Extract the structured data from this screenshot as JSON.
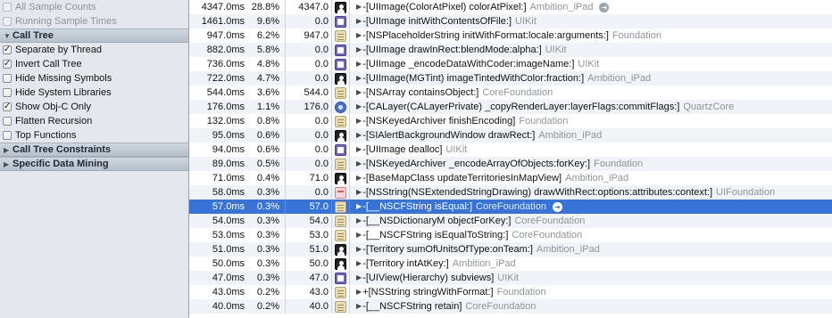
{
  "sidebar": {
    "sample_options": [
      {
        "label": "All Sample Counts",
        "checked": false,
        "disabled": true
      },
      {
        "label": "Running Sample Times",
        "checked": false,
        "disabled": true
      }
    ],
    "call_tree": {
      "title": "Call Tree",
      "options": [
        {
          "label": "Separate by Thread",
          "checked": true
        },
        {
          "label": "Invert Call Tree",
          "checked": true
        },
        {
          "label": "Hide Missing Symbols",
          "checked": false
        },
        {
          "label": "Hide System Libraries",
          "checked": false
        },
        {
          "label": "Show Obj-C Only",
          "checked": true
        },
        {
          "label": "Flatten Recursion",
          "checked": false
        },
        {
          "label": "Top Functions",
          "checked": false
        }
      ]
    },
    "call_tree_constraints": {
      "title": "Call Tree Constraints"
    },
    "specific_data_mining": {
      "title": "Specific Data Mining"
    }
  },
  "check_glyph": "✓",
  "table": {
    "selected_index": 14,
    "rows": [
      {
        "time": "4347.0ms",
        "pct": "28.8%",
        "self": "4347.0",
        "icon": "user",
        "symbol": "-[UIImage(ColorAtPixel) colorAtPixel:]",
        "library": "Ambition_iPad",
        "arrow": true
      },
      {
        "time": "1461.0ms",
        "pct": "9.6%",
        "self": "0.0",
        "icon": "kit",
        "symbol": "-[UIImage initWithContentsOfFile:]",
        "library": "UIKit"
      },
      {
        "time": "947.0ms",
        "pct": "6.2%",
        "self": "947.0",
        "icon": "fw",
        "symbol": "-[NSPlaceholderString initWithFormat:locale:arguments:]",
        "library": "Foundation"
      },
      {
        "time": "882.0ms",
        "pct": "5.8%",
        "self": "0.0",
        "icon": "kit",
        "symbol": "-[UIImage drawInRect:blendMode:alpha:]",
        "library": "UIKit"
      },
      {
        "time": "736.0ms",
        "pct": "4.8%",
        "self": "0.0",
        "icon": "kit",
        "symbol": "-[UIImage _encodeDataWithCoder:imageName:]",
        "library": "UIKit"
      },
      {
        "time": "722.0ms",
        "pct": "4.7%",
        "self": "0.0",
        "icon": "user",
        "symbol": "-[UIImage(MGTint) imageTintedWithColor:fraction:]",
        "library": "Ambition_iPad"
      },
      {
        "time": "544.0ms",
        "pct": "3.6%",
        "self": "544.0",
        "icon": "fw",
        "symbol": "-[NSArray containsObject:]",
        "library": "CoreFoundation"
      },
      {
        "time": "176.0ms",
        "pct": "1.1%",
        "self": "176.0",
        "icon": "qc",
        "symbol": "-[CALayer(CALayerPrivate) _copyRenderLayer:layerFlags:commitFlags:]",
        "library": "QuartzCore"
      },
      {
        "time": "132.0ms",
        "pct": "0.8%",
        "self": "0.0",
        "icon": "fw",
        "symbol": "-[NSKeyedArchiver finishEncoding]",
        "library": "Foundation"
      },
      {
        "time": "95.0ms",
        "pct": "0.6%",
        "self": "0.0",
        "icon": "user",
        "symbol": "-[SIAlertBackgroundWindow drawRect:]",
        "library": "Ambition_iPad"
      },
      {
        "time": "94.0ms",
        "pct": "0.6%",
        "self": "0.0",
        "icon": "kit",
        "symbol": "-[UIImage dealloc]",
        "library": "UIKit"
      },
      {
        "time": "89.0ms",
        "pct": "0.5%",
        "self": "0.0",
        "icon": "fw",
        "symbol": "-[NSKeyedArchiver _encodeArrayOfObjects:forKey:]",
        "library": "Foundation"
      },
      {
        "time": "71.0ms",
        "pct": "0.4%",
        "self": "71.0",
        "icon": "user",
        "symbol": "-[BaseMapClass updateTerritoriesInMapView]",
        "library": "Ambition_iPad"
      },
      {
        "time": "58.0ms",
        "pct": "0.3%",
        "self": "0.0",
        "icon": "fnd",
        "symbol": "-[NSString(NSExtendedStringDrawing) drawWithRect:options:attributes:context:]",
        "library": "UIFoundation"
      },
      {
        "time": "57.0ms",
        "pct": "0.3%",
        "self": "57.0",
        "icon": "fw",
        "symbol": "-[__NSCFString isEqual:]",
        "library": "CoreFoundation",
        "arrow": true
      },
      {
        "time": "54.0ms",
        "pct": "0.3%",
        "self": "54.0",
        "icon": "fw",
        "symbol": "-[__NSDictionaryM objectForKey:]",
        "library": "CoreFoundation"
      },
      {
        "time": "53.0ms",
        "pct": "0.3%",
        "self": "53.0",
        "icon": "fw",
        "symbol": "-[__NSCFString isEqualToString:]",
        "library": "CoreFoundation"
      },
      {
        "time": "51.0ms",
        "pct": "0.3%",
        "self": "51.0",
        "icon": "user",
        "symbol": "-[Territory sumOfUnitsOfType:onTeam:]",
        "library": "Ambition_iPad"
      },
      {
        "time": "50.0ms",
        "pct": "0.3%",
        "self": "50.0",
        "icon": "user",
        "symbol": "-[Territory intAtKey:]",
        "library": "Ambition_iPad"
      },
      {
        "time": "47.0ms",
        "pct": "0.3%",
        "self": "47.0",
        "icon": "kit",
        "symbol": "-[UIView(Hierarchy) subviews]",
        "library": "UIKit"
      },
      {
        "time": "43.0ms",
        "pct": "0.2%",
        "self": "43.0",
        "icon": "fw",
        "symbol": "+[NSString stringWithFormat:]",
        "library": "Foundation"
      },
      {
        "time": "40.0ms",
        "pct": "0.2%",
        "self": "40.0",
        "icon": "fw",
        "symbol": "-[__NSCFString retain]",
        "library": "CoreFoundation"
      }
    ]
  }
}
